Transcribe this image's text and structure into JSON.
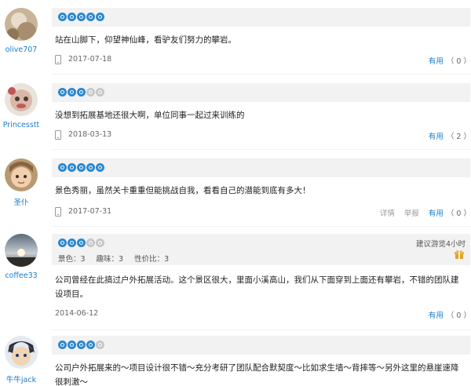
{
  "labels": {
    "helpful": "有用",
    "detail": "详情",
    "report": "举报"
  },
  "reviews": [
    {
      "user": "olive707",
      "stars": 5,
      "text": "站在山脚下，仰望神仙峰，看驴友们努力的攀岩。",
      "date": "2017-07-18",
      "from_mobile": true,
      "helpful_count": "（ 0 ）"
    },
    {
      "user": "Princesstt",
      "stars": 3,
      "text": "没想到拓展基地还很大啊，单位同事一起过来训练的",
      "date": "2018-03-13",
      "from_mobile": true,
      "helpful_count": "（ 2 ）"
    },
    {
      "user": "圣仆",
      "stars": 5,
      "text": "景色秀丽，虽然关卡重重但能挑战自我，看看自己的潜能到底有多大！",
      "date": "2017-07-31",
      "from_mobile": true,
      "helpful_count": "（ 0 ）"
    },
    {
      "user": "coffee33",
      "stars": 3,
      "scores": {
        "scenery": "景色：3",
        "fun": "趣味：3",
        "value": "性价比：3"
      },
      "visit_time": "建议游览4小时",
      "text": "公司曾经在此搞过户外拓展活动。这个景区很大，里面小溪高山，我们从下面穿到上面还有攀岩，不错的团队建设项目。",
      "date": "2014-06-12",
      "from_mobile": false,
      "helpful_count": "（ 0 ）"
    },
    {
      "user": "牛牛jack",
      "stars": 4,
      "text": "公司户外拓展来的～项目设计很不错～充分考研了团队配合默契度～比如求生墙～背摔等～另外这里的悬崖速降很刺激～"
    }
  ]
}
